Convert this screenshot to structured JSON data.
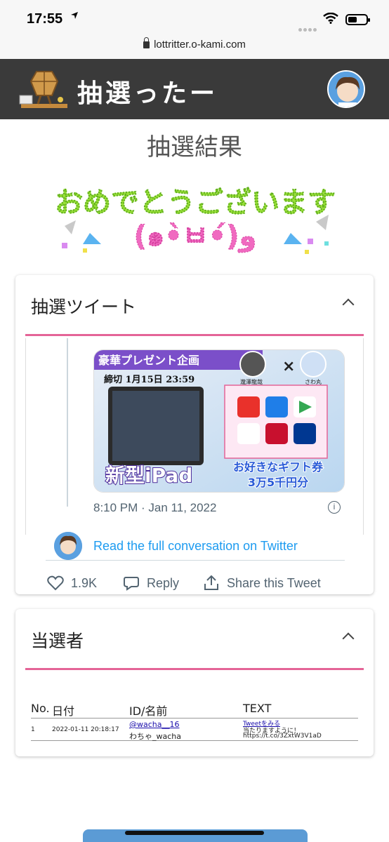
{
  "status_bar": {
    "time": "17:55",
    "url": "lottritter.o-kami.com"
  },
  "site": {
    "title": "抽選ったー",
    "page_heading": "抽選結果",
    "congrats_text": "おめでとうございます",
    "congrats_sub": "(๑•̀ㅂ•́)و"
  },
  "tweet_card": {
    "title": "抽選ツイート",
    "image": {
      "banner": "豪華プレゼント企画",
      "deadline": "締切 1月15日 23:59",
      "product": "新型iPad",
      "gift_line1": "お好きなギフト券",
      "gift_line2": "3万5千円分",
      "person1": "瀧澤龍哉",
      "person2": "さわ丸",
      "cross": "×"
    },
    "time": "8:10 PM · Jan 11, 2022",
    "read_full": "Read the full conversation on Twitter",
    "likes": "1.9K",
    "reply": "Reply",
    "share": "Share this Tweet"
  },
  "winners_card": {
    "title": "当選者",
    "columns": [
      "No.",
      "日付",
      "ID/名前",
      "TEXT"
    ],
    "rows": [
      {
        "no": "1",
        "date": "2022-01-11 20:18:17",
        "id": "@wacha__16",
        "name": "わちゃ_wacha",
        "text_link": "Tweetをみる",
        "text_line1": "当たりますように！",
        "text_line2": "https://t.co/3ZxtW3V1aD"
      }
    ]
  },
  "colors": {
    "header_bg": "#3a3a3a",
    "accent_pink": "#e46497",
    "twitter_blue": "#1d9bf0"
  }
}
